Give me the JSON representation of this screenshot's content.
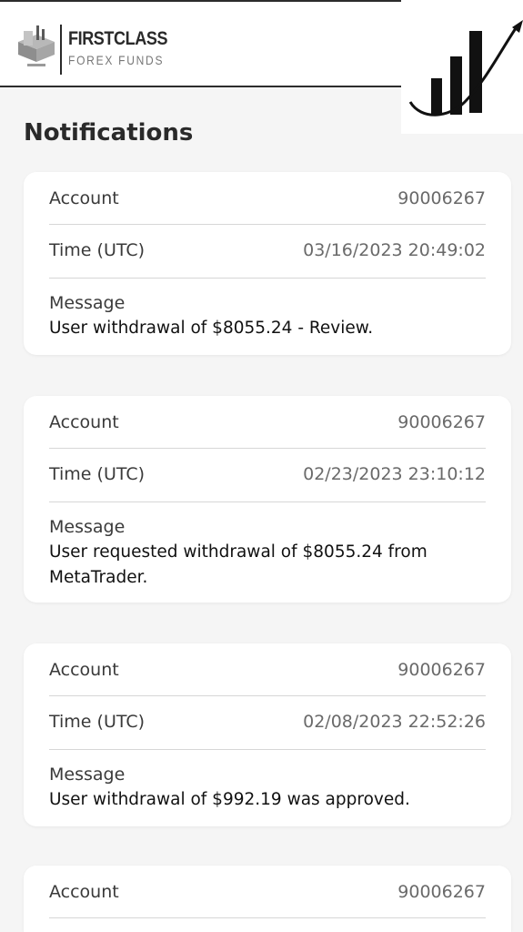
{
  "brand": {
    "line1": "FIRSTCLASS",
    "line2": "FOREX FUNDS"
  },
  "page": {
    "title": "Notifications"
  },
  "labels": {
    "account": "Account",
    "time": "Time (UTC)",
    "message": "Message"
  },
  "notifications": [
    {
      "account": "90006267",
      "time": "03/16/2023 20:49:02",
      "message": "User withdrawal of $8055.24 - Review."
    },
    {
      "account": "90006267",
      "time": "02/23/2023 23:10:12",
      "message": "User requested withdrawal of $8055.24 from MetaTrader."
    },
    {
      "account": "90006267",
      "time": "02/08/2023 22:52:26",
      "message": "User withdrawal of $992.19 was approved."
    },
    {
      "account": "90006267"
    }
  ],
  "icons": {
    "logo": "firstclass-logo-icon",
    "growth": "growth-chart-icon"
  },
  "colors": {
    "background": "#f5f5f5",
    "card": "#ffffff",
    "divider": "#d6d6d6",
    "text": "#1e1e1e"
  }
}
